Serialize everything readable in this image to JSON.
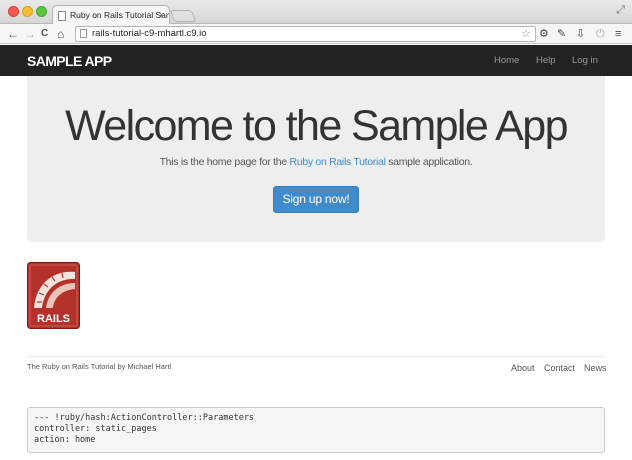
{
  "browser": {
    "tab_title": "Ruby on Rails Tutorial Sam",
    "tab_close": "×",
    "url": "rails-tutorial-c9-mhartl.c9.io",
    "nav": {
      "back": "←",
      "forward": "→",
      "reload": "C",
      "home": "⌂"
    },
    "toolbar_icons": [
      "star-icon",
      "gear-icon",
      "extension-icon",
      "download-icon",
      "power-icon",
      "menu-icon"
    ]
  },
  "navbar": {
    "brand": "SAMPLE APP",
    "links": [
      "Home",
      "Help",
      "Log in"
    ]
  },
  "hero": {
    "title": "Welcome to the Sample App",
    "lead_prefix": "This is the home page for the ",
    "lead_link": "Ruby on Rails Tutorial",
    "lead_suffix": " sample application.",
    "signup": "Sign up now!"
  },
  "rails_logo": {
    "text": "RAILS"
  },
  "footer": {
    "text": "The Ruby on Rails Tutorial by Michael Hartl",
    "links": [
      "About",
      "Contact",
      "News"
    ]
  },
  "debug": {
    "lines": [
      "--- !ruby/hash:ActionController::Parameters",
      "controller: static_pages",
      "action: home"
    ]
  },
  "colors": {
    "navbar_bg": "#222222",
    "jumbotron_bg": "#eeeeee",
    "primary": "#428bca",
    "debug_bg": "#f5f5f5"
  }
}
